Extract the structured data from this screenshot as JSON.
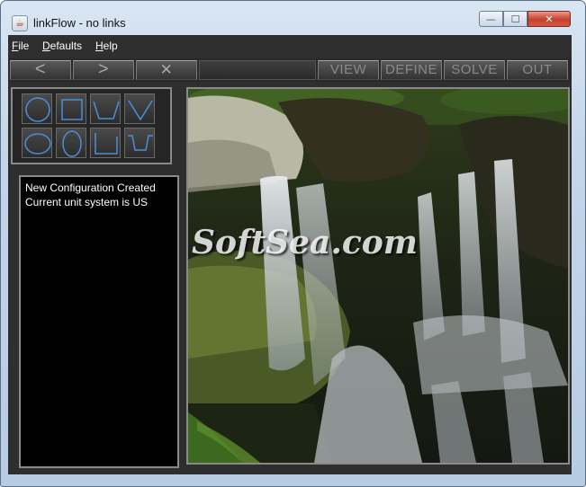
{
  "window": {
    "title": "linkFlow - no links",
    "app_icon_glyph": "☕",
    "minimize_glyph": "—",
    "maximize_glyph": "☐",
    "close_glyph": "✕"
  },
  "menu": {
    "items": [
      {
        "label": "File",
        "underline": "F",
        "rest": "ile"
      },
      {
        "label": "Defaults",
        "underline": "D",
        "rest": "efaults"
      },
      {
        "label": "Help",
        "underline": "H",
        "rest": "elp"
      }
    ]
  },
  "toolbar": {
    "back_label": "<",
    "forward_label": ">",
    "cancel_label": "✕",
    "view_label": "VIEW",
    "define_label": "DEFINE",
    "solve_label": "SOLVE",
    "out_label": "OUT"
  },
  "shapes": {
    "icons": [
      "circle-icon",
      "square-icon",
      "trapezoid-icon",
      "triangle-icon",
      "ellipse-icon",
      "oval-icon",
      "rectangle-icon",
      "complex-channel-icon"
    ],
    "stroke_color": "#4a8fd8"
  },
  "console": {
    "lines": [
      "New Configuration Created",
      "Current unit system is US"
    ]
  },
  "canvas": {
    "watermark": "SoftSea.com"
  }
}
